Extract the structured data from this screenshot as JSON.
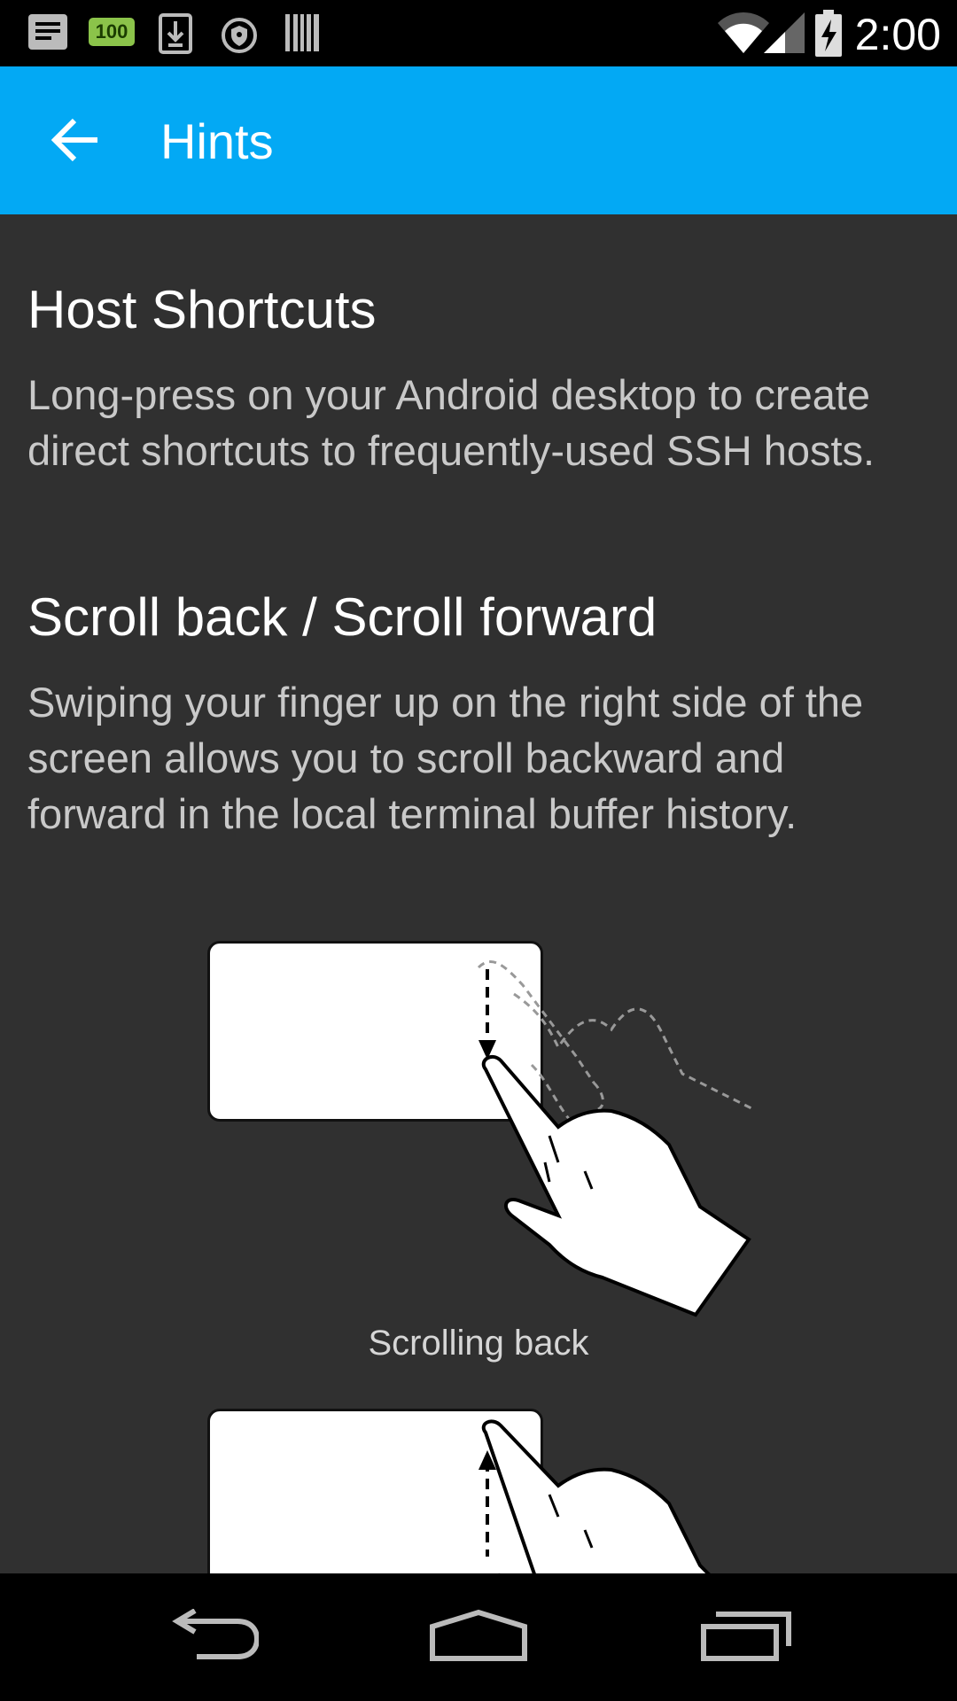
{
  "status_bar": {
    "time": "2:00",
    "notification_icons": [
      "message-icon",
      "battery-100-badge-icon",
      "download-icon",
      "vpn-shield-icon",
      "barcode-icon"
    ],
    "battery_badge": "100",
    "system_icons": [
      "wifi-icon",
      "signal-icon",
      "battery-charging-icon"
    ]
  },
  "app_bar": {
    "title": "Hints",
    "background": "#03a9f4",
    "nav_icon": "arrow-back-icon"
  },
  "sections": [
    {
      "heading": "Host Shortcuts",
      "body": "Long-press on your Android desktop to create direct shortcuts to frequently-used SSH hosts."
    },
    {
      "heading": "Scroll back / Scroll forward",
      "body": "Swiping your finger up on the right side of the screen allows you to scroll backward and forward in the local terminal buffer history."
    }
  ],
  "illustrations": [
    {
      "caption": "Scrolling back",
      "icon": "swipe-down-hand-icon"
    },
    {
      "caption": "",
      "icon": "swipe-up-hand-icon"
    }
  ],
  "nav_bar": {
    "buttons": [
      "back-nav-icon",
      "home-nav-icon",
      "recents-nav-icon"
    ]
  }
}
